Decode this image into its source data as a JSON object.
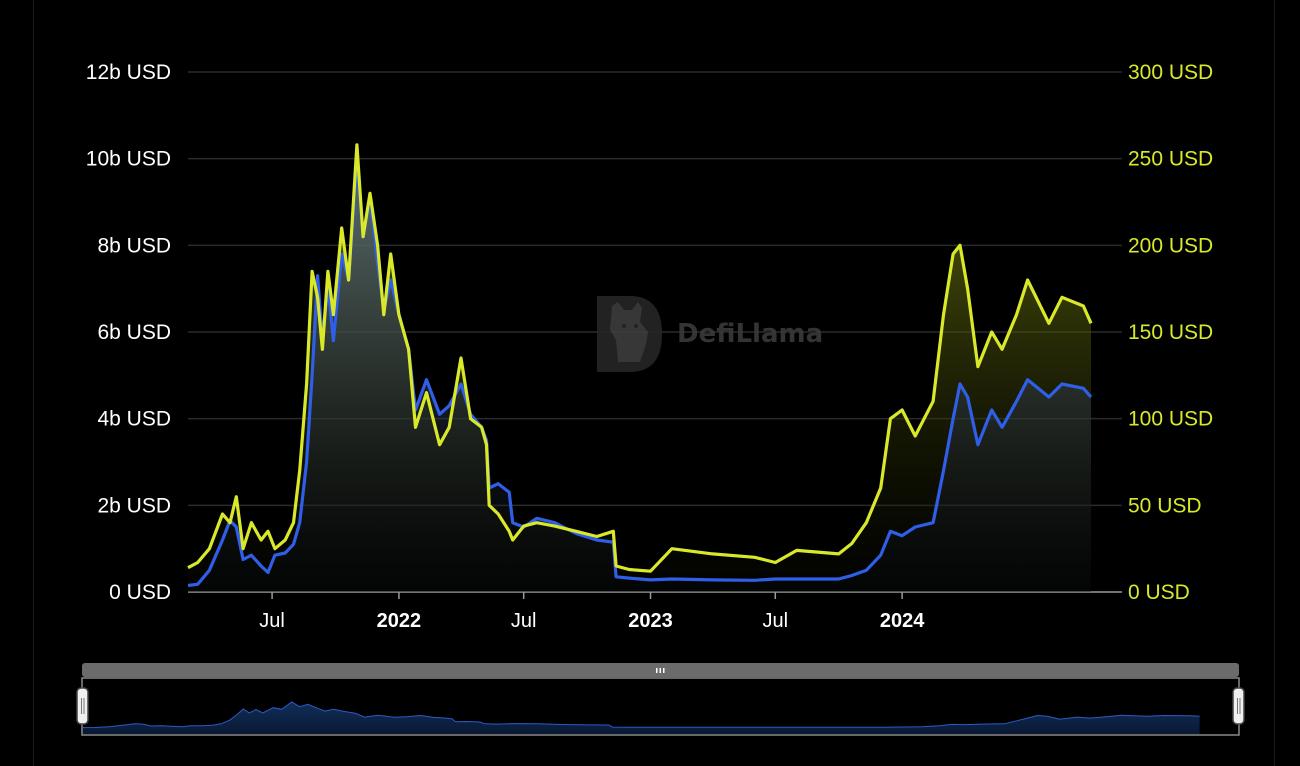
{
  "watermark": {
    "text": "DefiLlama",
    "icon": "llama-logo-icon"
  },
  "colors": {
    "background": "#000000",
    "grid": "#2a2a2a",
    "left_series": "#2f5ee8",
    "right_series": "#d9e92a",
    "right_axis_text": "#d9e92a",
    "slider_fill": "#0d1e3d",
    "slider_line": "#2b5cc4"
  },
  "chart_data": {
    "type": "line",
    "title": "",
    "x_range": [
      "2021-03-01",
      "2024-11-15"
    ],
    "x_ticks": [
      {
        "date": "2021-07-01",
        "label": "Jul",
        "major": false
      },
      {
        "date": "2022-01-01",
        "label": "2022",
        "major": true
      },
      {
        "date": "2022-07-01",
        "label": "Jul",
        "major": false
      },
      {
        "date": "2023-01-01",
        "label": "2023",
        "major": true
      },
      {
        "date": "2023-07-01",
        "label": "Jul",
        "major": false
      },
      {
        "date": "2024-01-01",
        "label": "2024",
        "major": true
      }
    ],
    "y_left": {
      "range": [
        0,
        12
      ],
      "ticks": [
        0,
        2,
        4,
        6,
        8,
        10,
        12
      ],
      "tick_labels": [
        "0 USD",
        "2b USD",
        "4b USD",
        "6b USD",
        "8b USD",
        "10b USD",
        "12b USD"
      ],
      "unit": "b USD"
    },
    "y_right": {
      "range": [
        0,
        300
      ],
      "ticks": [
        0,
        50,
        100,
        150,
        200,
        250,
        300
      ],
      "tick_labels": [
        "0 USD",
        "50 USD",
        "100 USD",
        "150 USD",
        "200 USD",
        "250 USD",
        "300 USD"
      ],
      "unit": "USD"
    },
    "grid": true,
    "series": [
      {
        "axis": "left",
        "color": "#2f5ee8",
        "points": [
          [
            "2021-03-01",
            0.15
          ],
          [
            "2021-03-15",
            0.18
          ],
          [
            "2021-04-01",
            0.5
          ],
          [
            "2021-04-20",
            1.2
          ],
          [
            "2021-05-01",
            1.65
          ],
          [
            "2021-05-10",
            1.5
          ],
          [
            "2021-05-20",
            0.75
          ],
          [
            "2021-06-01",
            0.85
          ],
          [
            "2021-06-15",
            0.6
          ],
          [
            "2021-06-25",
            0.45
          ],
          [
            "2021-07-05",
            0.85
          ],
          [
            "2021-07-20",
            0.9
          ],
          [
            "2021-08-01",
            1.1
          ],
          [
            "2021-08-10",
            1.6
          ],
          [
            "2021-08-20",
            3.0
          ],
          [
            "2021-08-28",
            5.0
          ],
          [
            "2021-09-05",
            7.3
          ],
          [
            "2021-09-12",
            5.8
          ],
          [
            "2021-09-20",
            7.1
          ],
          [
            "2021-09-28",
            5.8
          ],
          [
            "2021-10-10",
            7.8
          ],
          [
            "2021-10-20",
            7.2
          ],
          [
            "2021-11-01",
            10.0
          ],
          [
            "2021-11-10",
            8.2
          ],
          [
            "2021-11-20",
            9.1
          ],
          [
            "2021-12-01",
            7.6
          ],
          [
            "2021-12-10",
            6.5
          ],
          [
            "2021-12-20",
            7.2
          ],
          [
            "2022-01-01",
            6.4
          ],
          [
            "2022-01-15",
            5.6
          ],
          [
            "2022-01-25",
            4.2
          ],
          [
            "2022-02-10",
            4.9
          ],
          [
            "2022-03-01",
            4.1
          ],
          [
            "2022-03-15",
            4.3
          ],
          [
            "2022-04-01",
            4.8
          ],
          [
            "2022-04-15",
            4.1
          ],
          [
            "2022-05-01",
            3.8
          ],
          [
            "2022-05-08",
            3.5
          ],
          [
            "2022-05-12",
            2.4
          ],
          [
            "2022-05-25",
            2.5
          ],
          [
            "2022-06-10",
            2.3
          ],
          [
            "2022-06-15",
            1.6
          ],
          [
            "2022-07-01",
            1.5
          ],
          [
            "2022-07-20",
            1.7
          ],
          [
            "2022-08-15",
            1.6
          ],
          [
            "2022-09-15",
            1.35
          ],
          [
            "2022-10-15",
            1.2
          ],
          [
            "2022-11-08",
            1.15
          ],
          [
            "2022-11-12",
            0.35
          ],
          [
            "2022-12-01",
            0.32
          ],
          [
            "2023-01-01",
            0.28
          ],
          [
            "2023-02-01",
            0.3
          ],
          [
            "2023-04-01",
            0.28
          ],
          [
            "2023-06-01",
            0.27
          ],
          [
            "2023-07-01",
            0.3
          ],
          [
            "2023-08-01",
            0.3
          ],
          [
            "2023-10-01",
            0.3
          ],
          [
            "2023-10-20",
            0.38
          ],
          [
            "2023-11-10",
            0.5
          ],
          [
            "2023-12-01",
            0.85
          ],
          [
            "2023-12-15",
            1.4
          ],
          [
            "2024-01-01",
            1.3
          ],
          [
            "2024-01-20",
            1.5
          ],
          [
            "2024-02-15",
            1.6
          ],
          [
            "2024-03-01",
            2.8
          ],
          [
            "2024-03-15",
            4.0
          ],
          [
            "2024-03-25",
            4.8
          ],
          [
            "2024-04-05",
            4.5
          ],
          [
            "2024-04-20",
            3.4
          ],
          [
            "2024-05-10",
            4.2
          ],
          [
            "2024-05-25",
            3.8
          ],
          [
            "2024-06-15",
            4.4
          ],
          [
            "2024-07-01",
            4.9
          ],
          [
            "2024-08-01",
            4.5
          ],
          [
            "2024-08-20",
            4.8
          ],
          [
            "2024-09-20",
            4.7
          ],
          [
            "2024-10-01",
            4.5
          ]
        ]
      },
      {
        "axis": "right",
        "color": "#d9e92a",
        "points": [
          [
            "2021-03-01",
            14
          ],
          [
            "2021-03-15",
            17
          ],
          [
            "2021-04-01",
            25
          ],
          [
            "2021-04-20",
            45
          ],
          [
            "2021-05-01",
            40
          ],
          [
            "2021-05-10",
            55
          ],
          [
            "2021-05-20",
            25
          ],
          [
            "2021-06-01",
            40
          ],
          [
            "2021-06-15",
            30
          ],
          [
            "2021-06-25",
            35
          ],
          [
            "2021-07-05",
            25
          ],
          [
            "2021-07-20",
            30
          ],
          [
            "2021-08-01",
            40
          ],
          [
            "2021-08-10",
            70
          ],
          [
            "2021-08-20",
            120
          ],
          [
            "2021-08-28",
            185
          ],
          [
            "2021-09-05",
            170
          ],
          [
            "2021-09-12",
            140
          ],
          [
            "2021-09-20",
            185
          ],
          [
            "2021-09-28",
            160
          ],
          [
            "2021-10-10",
            210
          ],
          [
            "2021-10-20",
            180
          ],
          [
            "2021-11-01",
            258
          ],
          [
            "2021-11-10",
            205
          ],
          [
            "2021-11-20",
            230
          ],
          [
            "2021-12-01",
            200
          ],
          [
            "2021-12-10",
            160
          ],
          [
            "2021-12-20",
            195
          ],
          [
            "2022-01-01",
            160
          ],
          [
            "2022-01-15",
            140
          ],
          [
            "2022-01-25",
            95
          ],
          [
            "2022-02-10",
            115
          ],
          [
            "2022-03-01",
            85
          ],
          [
            "2022-03-15",
            95
          ],
          [
            "2022-04-01",
            135
          ],
          [
            "2022-04-15",
            100
          ],
          [
            "2022-05-01",
            95
          ],
          [
            "2022-05-08",
            85
          ],
          [
            "2022-05-12",
            50
          ],
          [
            "2022-05-25",
            45
          ],
          [
            "2022-06-10",
            35
          ],
          [
            "2022-06-15",
            30
          ],
          [
            "2022-07-01",
            38
          ],
          [
            "2022-07-20",
            40
          ],
          [
            "2022-08-15",
            38
          ],
          [
            "2022-09-15",
            35
          ],
          [
            "2022-10-15",
            32
          ],
          [
            "2022-11-08",
            35
          ],
          [
            "2022-11-12",
            15
          ],
          [
            "2022-12-01",
            13
          ],
          [
            "2023-01-01",
            12
          ],
          [
            "2023-02-01",
            25
          ],
          [
            "2023-04-01",
            22
          ],
          [
            "2023-06-01",
            20
          ],
          [
            "2023-07-01",
            17
          ],
          [
            "2023-08-01",
            24
          ],
          [
            "2023-10-01",
            22
          ],
          [
            "2023-10-20",
            28
          ],
          [
            "2023-11-10",
            40
          ],
          [
            "2023-12-01",
            60
          ],
          [
            "2023-12-15",
            100
          ],
          [
            "2024-01-01",
            105
          ],
          [
            "2024-01-20",
            90
          ],
          [
            "2024-02-15",
            110
          ],
          [
            "2024-03-01",
            160
          ],
          [
            "2024-03-15",
            195
          ],
          [
            "2024-03-25",
            200
          ],
          [
            "2024-04-05",
            175
          ],
          [
            "2024-04-20",
            130
          ],
          [
            "2024-05-10",
            150
          ],
          [
            "2024-05-25",
            140
          ],
          [
            "2024-06-15",
            160
          ],
          [
            "2024-07-01",
            180
          ],
          [
            "2024-08-01",
            155
          ],
          [
            "2024-08-20",
            170
          ],
          [
            "2024-09-20",
            165
          ],
          [
            "2024-10-01",
            155
          ]
        ]
      }
    ]
  },
  "range_slider": {
    "start_fraction": 0,
    "end_fraction": 1,
    "grip_icon": "grip-lines-icon",
    "left_handle_icon": "slider-handle-icon",
    "right_handle_icon": "slider-handle-icon"
  }
}
